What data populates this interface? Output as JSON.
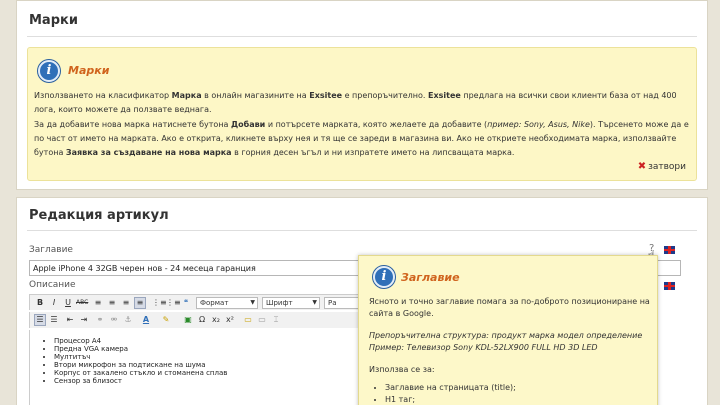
{
  "brands_section": {
    "title": "Марки",
    "notice": {
      "title": "Марки",
      "p1": [
        {
          "t": "Използването на класификатор ",
          "s": ""
        },
        {
          "t": "Марка",
          "s": "b"
        },
        {
          "t": " в онлайн магазините на ",
          "s": ""
        },
        {
          "t": "Exsitee",
          "s": "b"
        },
        {
          "t": " е препоръчително. ",
          "s": ""
        },
        {
          "t": "Exsitee",
          "s": "b"
        },
        {
          "t": " предлага на всички свои клиенти база от над 400 лога, които можете да ползвате веднага.",
          "s": ""
        }
      ],
      "p2": [
        {
          "t": "За да добавите нова марка натиснете бутона ",
          "s": ""
        },
        {
          "t": "Добави",
          "s": "b"
        },
        {
          "t": " и потърсете марката, която желаете да добавите (",
          "s": ""
        },
        {
          "t": "пример: Sony, Asus, Nike",
          "s": "i"
        },
        {
          "t": "). Търсенето може да е по част от името на марката. Ако е открита, кликнете върху нея и тя ще се зареди в магазина ви. Ако не откриете необходимата марка, използвайте бутона ",
          "s": ""
        },
        {
          "t": "Заявка за създаване на нова марка",
          "s": "b"
        },
        {
          "t": " в горния десен ъгъл и ни изпратете името на липсващата марка.",
          "s": ""
        }
      ],
      "close_label": "затвори"
    }
  },
  "edit_section": {
    "title": "Редакция артикул",
    "title_label": "Заглавие",
    "title_value": "Apple iPhone 4 32GB черен нов - 24 месеца гаранция",
    "help_mark": "?",
    "desc_label": "Описание",
    "toolbar": {
      "row1": [
        "B",
        "I",
        "U",
        "ABC",
        "≡",
        "≡",
        "≡",
        "≡",
        "⋮≡",
        "⋮≡",
        "❝"
      ],
      "format_label": "Формат",
      "font_label": "Шрифт",
      "size_label": "Ра",
      "row2": [
        "☰",
        "☰",
        "⇤",
        "⇥",
        "⚭",
        "⚮",
        "⚓",
        "A",
        "✎",
        "▣",
        "Ω",
        "x₂",
        "x²",
        "▭",
        "▭",
        "⌶"
      ]
    },
    "description_items": [
      "Процесор A4",
      "Предна VGA камера",
      "Мултитъч",
      "Втори микрофон за подтискане на шума",
      "Корпус от закалено стъкло и стоманена сплав",
      "Сензор за близост"
    ]
  },
  "tooltip": {
    "title": "Заглавие",
    "text1": "Ясното и точно заглавие помага за по-доброто позициониране на сайта в Google.",
    "text2": "Препоръчителна структура: продукт марка модел определение Пример: Телевизор Sony KDL-52LX900 FULL HD 3D LED",
    "text3": "Използва се за:",
    "uses": [
      "Заглавие на страницата (title);",
      "H1 таг;"
    ]
  },
  "colors": {
    "notice_bg": "#fdf7c6",
    "accent_title": "#d0641e",
    "info_icon": "#2f6fb8",
    "page_bg": "#e8e4d8"
  },
  "icons": [
    "info-icon",
    "close-x-icon",
    "help-question-icon",
    "uk-flag-icon",
    "hand-cursor-icon"
  ]
}
